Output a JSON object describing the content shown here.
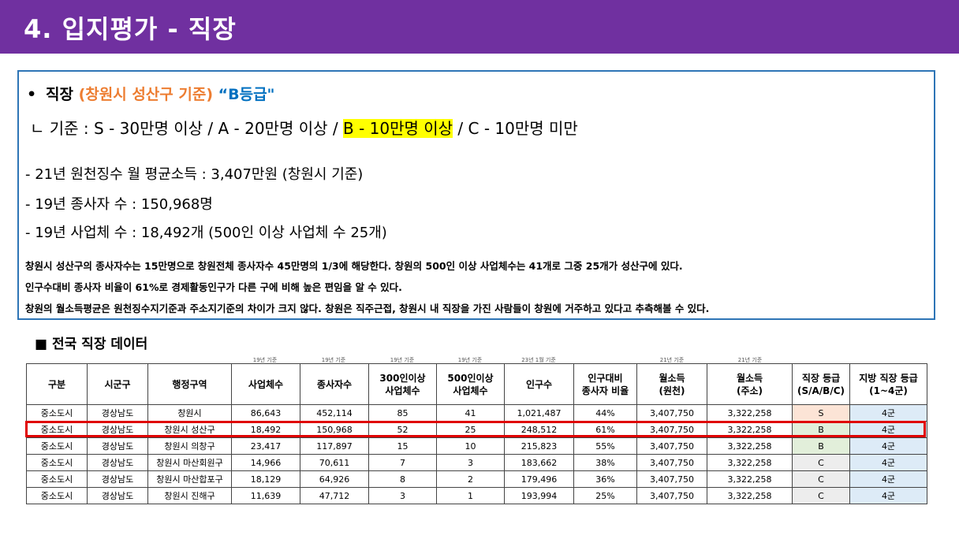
{
  "header": {
    "title": "4. 입지평가 - 직장"
  },
  "summary": {
    "bullet": "•",
    "line1_prefix": "직장 ",
    "line1_orange": "(창원시 성산구 기준)",
    "line1_blue": " “B등급\"",
    "criteria_prefix": "ㄴ 기준 : S - 30만명 이상 / A - 20만명 이상 / ",
    "criteria_highlight": "B - 10만명 이상",
    "criteria_suffix": " / C - 10만명 미만",
    "income": "- 21년 원천징수 월 평균소득 : 3,407만원 (창원시 기준)",
    "employees": "- 19년 종사자 수 : 150,968명",
    "businesses": "- 19년 사업체 수 : 18,492개 (500인 이상 사업체 수 25개)",
    "note1": "창원시 성산구의 종사자수는 15만명으로 창원전체 종사자수 45만명의 1/3에 해당한다. 창원의 500인 이상 사업체수는 41개로 그중 25개가 성산구에 있다.",
    "note2": "인구수대비 종사자 비율이 61%로 경제활동인구가 다른 구에 비해 높은 편임을 알 수 있다.",
    "note3": "창원의 월소득평균은 원천징수지기준과 주소지기준의 차이가 크지 않다. 창원은 직주근접, 창원시 내 직장을 가진 사람들이 창원에 거주하고 있다고 추측해볼 수 있다."
  },
  "section": {
    "title": "■ 전국 직장 데이터"
  },
  "basis_notes": {
    "b_business": "19년 기준",
    "b_employees": "19년 기준",
    "b_300": "19년 기준",
    "b_500": "19년 기준",
    "b_population": "23년 1월 기준",
    "b_income_source": "21년 기준",
    "b_income_address": "21년 기준"
  },
  "table": {
    "headers": [
      "구분",
      "시군구",
      "행정구역",
      "사업체수",
      "종사자수",
      "300인이상\n사업체수",
      "500인이상\n사업체수",
      "인구수",
      "인구대비\n종사자 비율",
      "월소득\n(원천)",
      "월소득\n(주소)",
      "직장 등급\n(S/A/B/C)",
      "지방 직장 등급\n(1~4군)"
    ],
    "rows": [
      [
        "중소도시",
        "경상남도",
        "창원시",
        "86,643",
        "452,114",
        "85",
        "41",
        "1,021,487",
        "44%",
        "3,407,750",
        "3,322,258",
        "S",
        "4군"
      ],
      [
        "중소도시",
        "경상남도",
        "창원시 성산구",
        "18,492",
        "150,968",
        "52",
        "25",
        "248,512",
        "61%",
        "3,407,750",
        "3,322,258",
        "B",
        "4군"
      ],
      [
        "중소도시",
        "경상남도",
        "창원시 의창구",
        "23,417",
        "117,897",
        "15",
        "10",
        "215,823",
        "55%",
        "3,407,750",
        "3,322,258",
        "B",
        "4군"
      ],
      [
        "중소도시",
        "경상남도",
        "창원시 마산회원구",
        "14,966",
        "70,611",
        "7",
        "3",
        "183,662",
        "38%",
        "3,407,750",
        "3,322,258",
        "C",
        "4군"
      ],
      [
        "중소도시",
        "경상남도",
        "창원시 마산합포구",
        "18,129",
        "64,926",
        "8",
        "2",
        "179,496",
        "36%",
        "3,407,750",
        "3,322,258",
        "C",
        "4군"
      ],
      [
        "중소도시",
        "경상남도",
        "창원시 진해구",
        "11,639",
        "47,712",
        "3",
        "1",
        "193,994",
        "25%",
        "3,407,750",
        "3,322,258",
        "C",
        "4군"
      ]
    ],
    "highlighted_row": 1,
    "grade_colors": {
      "S": "#fce4d6",
      "B": "#e2efda",
      "C": "#ededed"
    },
    "region_color": "#ddebf7"
  },
  "colors": {
    "header_bg": "#7030a0",
    "box_border": "#2e75b6",
    "highlight_border": "#e00000",
    "accent_orange": "#ed7d31",
    "accent_blue": "#0070c0",
    "text_highlight": "#ffff00"
  }
}
